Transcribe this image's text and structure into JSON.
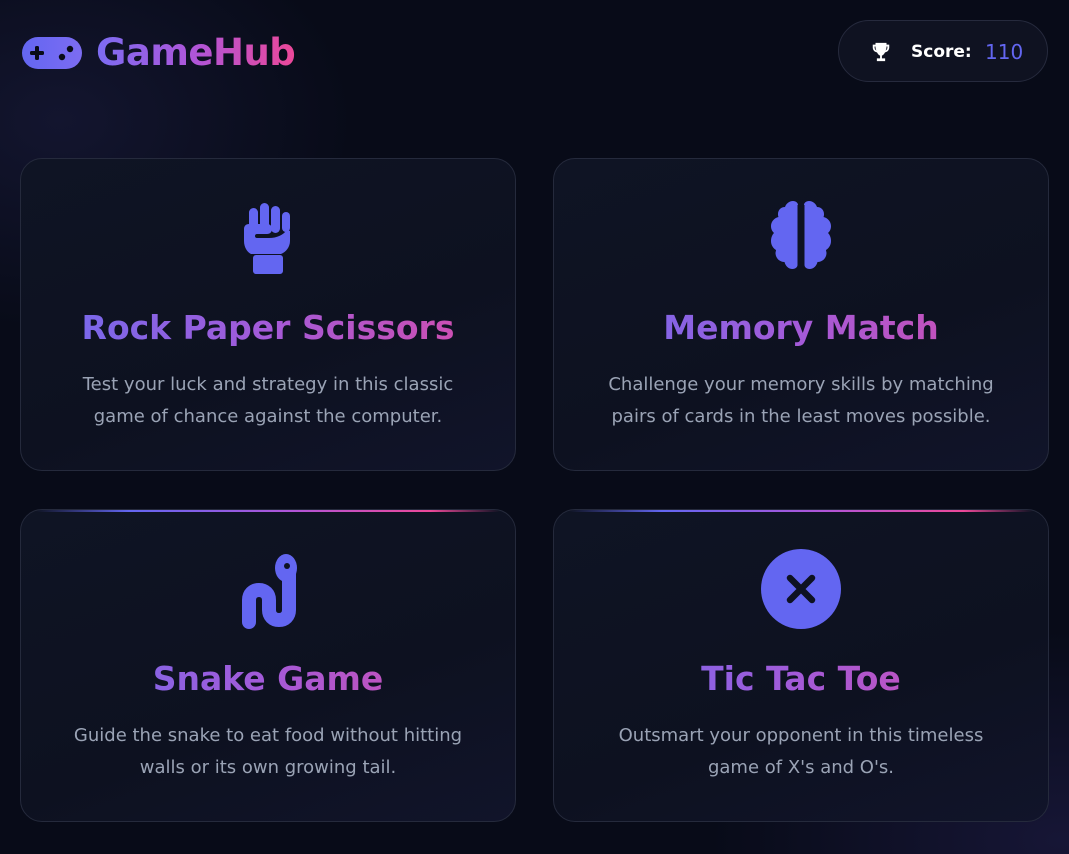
{
  "header": {
    "brand": "GameHub",
    "brand_icon": "gamepad-icon",
    "score_icon": "trophy-icon",
    "score_label": "Score:",
    "score_value": "110"
  },
  "games": [
    {
      "title": "Rock Paper Scissors",
      "description": "Test your luck and strategy in this classic game of chance against the computer.",
      "icon": "fist-icon"
    },
    {
      "title": "Memory Match",
      "description": "Challenge your memory skills by matching pairs of cards in the least moves possible.",
      "icon": "brain-icon"
    },
    {
      "title": "Snake Game",
      "description": "Guide the snake to eat food without hitting walls or its own growing tail.",
      "icon": "snake-icon"
    },
    {
      "title": "Tic Tac Toe",
      "description": "Outsmart your opponent in this timeless game of X's and O's.",
      "icon": "x-circle-icon"
    }
  ],
  "colors": {
    "background": "#080b18",
    "accent_indigo": "#6366f1",
    "accent_purple": "#a855f7",
    "accent_pink": "#ec4899",
    "text_muted": "#9aa3b5"
  }
}
